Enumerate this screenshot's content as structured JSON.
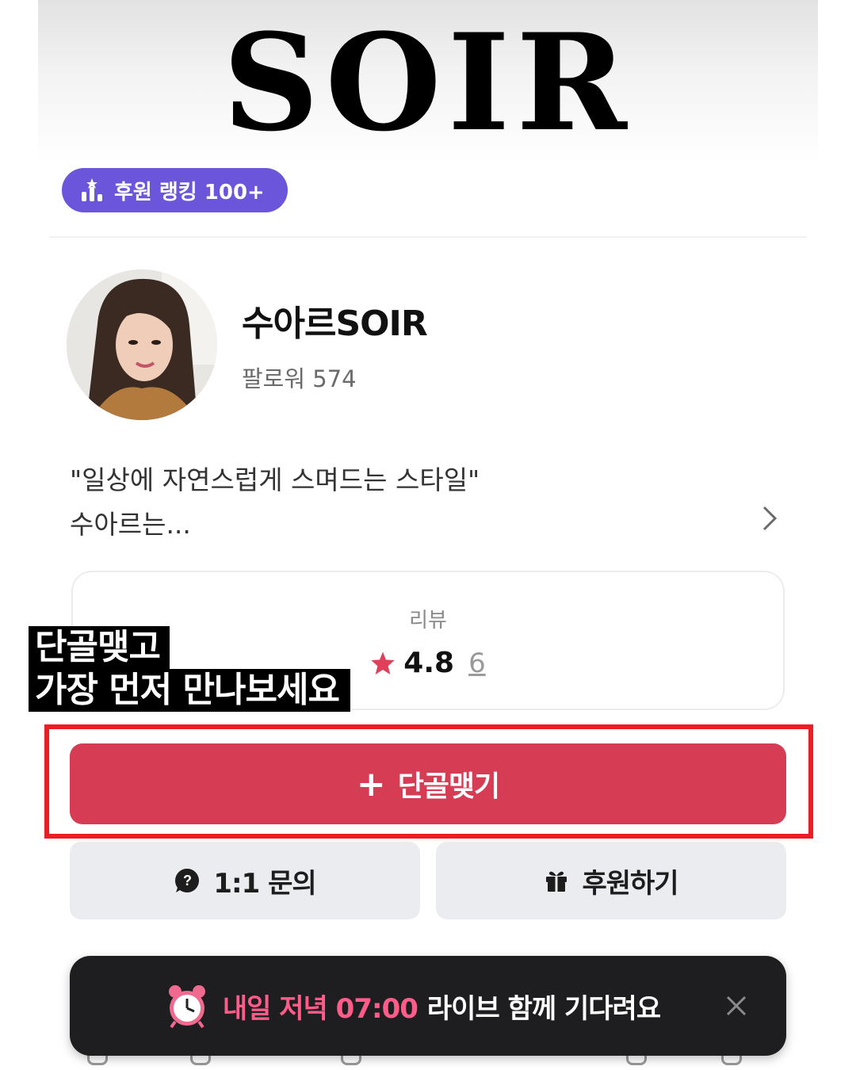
{
  "brand": {
    "logo_text": "SOIR"
  },
  "badge": {
    "label": "후원 랭킹 100+",
    "icon": "ranking-chart-icon",
    "color": "#6a55db"
  },
  "profile": {
    "name": "수아르SOIR",
    "followers": "팔로워 574",
    "bio_line1": "\"일상에 자연스럽게 스며드는 스타일\"",
    "bio_line2": "수아르는..."
  },
  "review": {
    "label": "리뷰",
    "score": "4.8",
    "count": "6",
    "star_color": "#e0405a"
  },
  "caption": {
    "line1": "단골맺고",
    "line2": "가장 먼저 만나보세요"
  },
  "actions": {
    "subscribe_label": "단골맺기",
    "subscribe_color": "#d63d55",
    "inquiry_label": "1:1 문의",
    "support_label": "후원하기"
  },
  "toast": {
    "time_text": "내일 저녁 07:00",
    "message": "라이브 함께 기다려요",
    "icon": "alarm-clock-icon",
    "accent": "#ff5c8a"
  }
}
